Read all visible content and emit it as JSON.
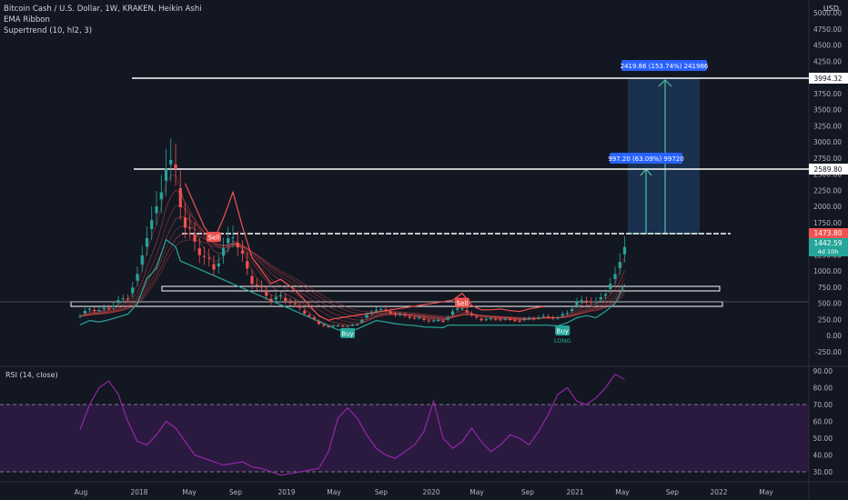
{
  "header": {
    "title": "Bitcoin Cash / U.S. Dollar, 1W, KRAKEN, Heikin Ashi",
    "indicator1": "EMA Ribbon",
    "indicator2": "Supertrend (10, hl2, 3)",
    "rsi_label": "RSI (14, close)",
    "currency": "USD"
  },
  "colors": {
    "background": "#131722",
    "up": "#26a69a",
    "down": "#ef5350",
    "rsi": "#9c27b0",
    "measure_box": "#1e3a5f",
    "measure_label": "#2962ff"
  },
  "chart_data": [
    {
      "type": "candlestick",
      "title": "Bitcoin Cash / U.S. Dollar, 1W, KRAKEN, Heikin Ashi",
      "x_tick_labels": [
        "Aug",
        "2018",
        "May",
        "Sep",
        "2019",
        "May",
        "Sep",
        "2020",
        "May",
        "Sep",
        "2021",
        "May",
        "Sep",
        "2022",
        "May"
      ],
      "y_tick_labels": [
        "5000.00",
        "4750.00",
        "4500.00",
        "4250.00",
        "4000.00",
        "3750.00",
        "3500.00",
        "3250.00",
        "3000.00",
        "2750.00",
        "2500.00",
        "2250.00",
        "2000.00",
        "1750.00",
        "1500.00",
        "1250.00",
        "1000.00",
        "750.00",
        "500.00",
        "250.00",
        "0.00",
        "-250.00"
      ],
      "ylim": [
        -450,
        5050
      ],
      "close_series": [
        [
          0,
          300
        ],
        [
          2,
          420
        ],
        [
          4,
          380
        ],
        [
          6,
          440
        ],
        [
          8,
          520
        ],
        [
          10,
          600
        ],
        [
          12,
          900
        ],
        [
          14,
          1600
        ],
        [
          16,
          1900
        ],
        [
          18,
          2700
        ],
        [
          20,
          2500
        ],
        [
          22,
          1700
        ],
        [
          24,
          1450
        ],
        [
          26,
          1200
        ],
        [
          28,
          1050
        ],
        [
          30,
          1300
        ],
        [
          32,
          1600
        ],
        [
          34,
          1200
        ],
        [
          36,
          850
        ],
        [
          38,
          700
        ],
        [
          40,
          550
        ],
        [
          42,
          600
        ],
        [
          44,
          520
        ],
        [
          46,
          420
        ],
        [
          48,
          300
        ],
        [
          50,
          180
        ],
        [
          52,
          130
        ],
        [
          54,
          160
        ],
        [
          56,
          140
        ],
        [
          58,
          180
        ],
        [
          60,
          300
        ],
        [
          62,
          420
        ],
        [
          64,
          380
        ],
        [
          66,
          330
        ],
        [
          68,
          300
        ],
        [
          70,
          280
        ],
        [
          72,
          240
        ],
        [
          74,
          230
        ],
        [
          76,
          220
        ],
        [
          78,
          360
        ],
        [
          80,
          440
        ],
        [
          82,
          300
        ],
        [
          84,
          250
        ],
        [
          86,
          250
        ],
        [
          88,
          260
        ],
        [
          90,
          240
        ],
        [
          92,
          230
        ],
        [
          94,
          260
        ],
        [
          96,
          280
        ],
        [
          98,
          290
        ],
        [
          100,
          270
        ],
        [
          102,
          360
        ],
        [
          104,
          500
        ],
        [
          106,
          560
        ],
        [
          108,
          500
        ],
        [
          110,
          680
        ],
        [
          112,
          900
        ],
        [
          114,
          1442.59
        ]
      ],
      "levels": [
        3994.32,
        2589.8,
        1473.8,
        750,
        500
      ],
      "price_labels": [
        "3994.32",
        "2589.80",
        "1473.80",
        "1442.59",
        "4d 10h"
      ],
      "measures": [
        {
          "label": "2419.86 (153.74%) 241986",
          "from": 1580,
          "to": 4000
        },
        {
          "label": "997.20 (63.09%) 99720",
          "from": 1580,
          "to": 2580
        }
      ],
      "signals": [
        {
          "label": "Sell",
          "x": 28,
          "price": 1520
        },
        {
          "label": "Buy",
          "x": 56,
          "price": 30
        },
        {
          "label": "Sell",
          "x": 80,
          "price": 500
        },
        {
          "label": "Buy",
          "x": 101,
          "price": 70
        }
      ],
      "long_label": "LONG"
    },
    {
      "type": "line",
      "title": "RSI (14, close)",
      "y_tick_labels": [
        "90.00",
        "80.00",
        "70.00",
        "60.00",
        "50.00",
        "40.00",
        "30.00"
      ],
      "ylim": [
        25,
        92
      ],
      "bands": [
        30,
        70
      ],
      "values": [
        [
          0,
          55
        ],
        [
          2,
          70
        ],
        [
          4,
          80
        ],
        [
          6,
          84
        ],
        [
          8,
          76
        ],
        [
          10,
          60
        ],
        [
          12,
          48
        ],
        [
          14,
          46
        ],
        [
          16,
          52
        ],
        [
          18,
          60
        ],
        [
          20,
          56
        ],
        [
          22,
          48
        ],
        [
          24,
          40
        ],
        [
          26,
          38
        ],
        [
          28,
          36
        ],
        [
          30,
          34
        ],
        [
          32,
          35
        ],
        [
          34,
          36
        ],
        [
          36,
          33
        ],
        [
          38,
          32
        ],
        [
          40,
          30
        ],
        [
          42,
          28
        ],
        [
          44,
          29
        ],
        [
          46,
          30
        ],
        [
          48,
          31
        ],
        [
          50,
          32
        ],
        [
          52,
          42
        ],
        [
          54,
          62
        ],
        [
          56,
          68
        ],
        [
          58,
          62
        ],
        [
          60,
          52
        ],
        [
          62,
          44
        ],
        [
          64,
          40
        ],
        [
          66,
          38
        ],
        [
          68,
          42
        ],
        [
          70,
          46
        ],
        [
          72,
          54
        ],
        [
          74,
          72
        ],
        [
          76,
          50
        ],
        [
          78,
          44
        ],
        [
          80,
          48
        ],
        [
          82,
          56
        ],
        [
          84,
          48
        ],
        [
          86,
          42
        ],
        [
          88,
          46
        ],
        [
          90,
          52
        ],
        [
          92,
          50
        ],
        [
          94,
          46
        ],
        [
          96,
          54
        ],
        [
          98,
          64
        ],
        [
          100,
          76
        ],
        [
          102,
          80
        ],
        [
          104,
          72
        ],
        [
          106,
          70
        ],
        [
          108,
          74
        ],
        [
          110,
          80
        ],
        [
          112,
          88
        ],
        [
          114,
          85
        ]
      ]
    }
  ]
}
